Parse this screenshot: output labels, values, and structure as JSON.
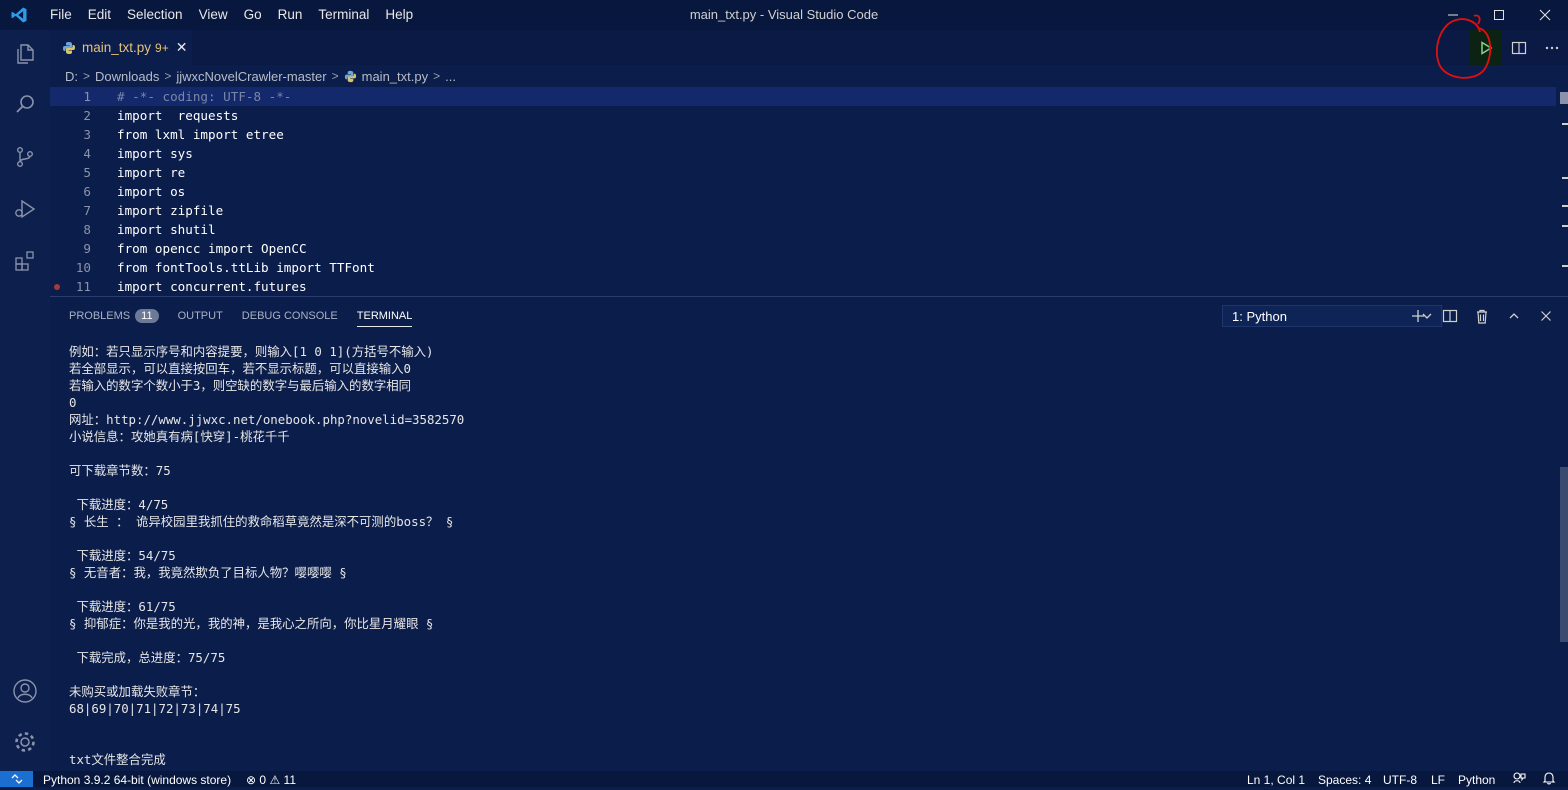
{
  "titlebar": {
    "menu": [
      "File",
      "Edit",
      "Selection",
      "View",
      "Go",
      "Run",
      "Terminal",
      "Help"
    ],
    "window_title": "main_txt.py - Visual Studio Code"
  },
  "tab": {
    "label": "main_txt.py",
    "badge": "9+"
  },
  "breadcrumb": [
    "D:",
    "Downloads",
    "jjwxcNovelCrawler-master",
    "main_txt.py",
    "..."
  ],
  "editor": {
    "lines": [
      {
        "n": "1",
        "text": "# -*- coding: UTF-8 -*-"
      },
      {
        "n": "2",
        "text": "import  requests"
      },
      {
        "n": "3",
        "text": "from lxml import etree"
      },
      {
        "n": "4",
        "text": "import sys"
      },
      {
        "n": "5",
        "text": "import re"
      },
      {
        "n": "6",
        "text": "import os"
      },
      {
        "n": "7",
        "text": "import zipfile"
      },
      {
        "n": "8",
        "text": "import shutil"
      },
      {
        "n": "9",
        "text": "from opencc import OpenCC"
      },
      {
        "n": "10",
        "text": "from fontTools.ttLib import TTFont"
      },
      {
        "n": "11",
        "text": "import concurrent.futures"
      }
    ]
  },
  "panel": {
    "tabs": [
      "PROBLEMS",
      "OUTPUT",
      "DEBUG CONSOLE",
      "TERMINAL"
    ],
    "problems_count": "11",
    "terminal_select": "1: Python",
    "terminal_lines": [
      "例如：若只显示序号和内容提要，则输入[1 0 1](方括号不输入)",
      "若全部显示，可以直接按回车，若不显示标题，可以直接输入0",
      "若输入的数字个数小于3，则空缺的数字与最后输入的数字相同",
      "0",
      "网址：http://www.jjwxc.net/onebook.php?novelid=3582570",
      "小说信息：攻她真有病[快穿]-桃花千千",
      "",
      "可下载章节数：75",
      "",
      " 下载进度：4/75",
      "§ 长生 ： 诡异校园里我抓住的救命稻草竟然是深不可测的boss？ §",
      "",
      " 下载进度：54/75",
      "§ 无音者：我，我竟然欺负了目标人物？嘤嘤嘤 §",
      "",
      " 下载进度：61/75",
      "§ 抑郁症：你是我的光，我的神，是我心之所向，你比星月耀眼 §",
      "",
      " 下载完成，总进度：75/75",
      "",
      "未购买或加载失败章节：",
      "68|69|70|71|72|73|74|75",
      "",
      "",
      "txt文件整合完成"
    ]
  },
  "statusbar": {
    "python": "Python 3.9.2 64-bit (windows store)",
    "errors": "0",
    "warnings": "11",
    "position": "Ln 1, Col 1",
    "spaces": "Spaces: 4",
    "encoding": "UTF-8",
    "eol": "LF",
    "language": "Python"
  },
  "colors": {
    "background": "#0b1d4a",
    "titlebar": "#07173d",
    "tab_modified": "#e5c07b",
    "run_icon": "#89d185",
    "annotation": "#e01010"
  }
}
